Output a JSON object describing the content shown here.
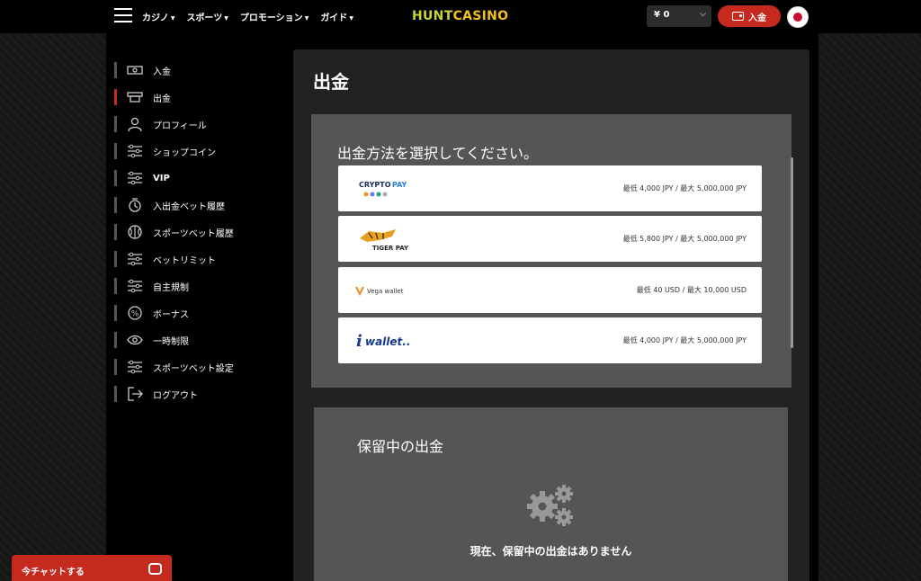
{
  "header": {
    "nav": [
      {
        "label": "カジノ"
      },
      {
        "label": "スポーツ"
      },
      {
        "label": "プロモーション"
      },
      {
        "label": "ガイド"
      }
    ],
    "logo_part1": "HUNT",
    "logo_part2": "CASINO",
    "balance": "¥ 0",
    "deposit_label": "入金"
  },
  "sidebar": {
    "items": [
      {
        "label": "入金",
        "icon": "cash-icon"
      },
      {
        "label": "出金",
        "icon": "cash-out-icon",
        "active": true
      },
      {
        "label": "プロフィール",
        "icon": "user-icon"
      },
      {
        "label": "ショップコイン",
        "icon": "sliders-icon"
      },
      {
        "label": "VIP",
        "icon": "sliders-icon"
      },
      {
        "label": "入出金ベット履歴",
        "icon": "history-icon"
      },
      {
        "label": "スポーツベット履歴",
        "icon": "ball-icon"
      },
      {
        "label": "ベットリミット",
        "icon": "sliders-icon"
      },
      {
        "label": "自主規制",
        "icon": "sliders-icon"
      },
      {
        "label": "ボーナス",
        "icon": "percent-icon"
      },
      {
        "label": "一時制限",
        "icon": "eye-icon"
      },
      {
        "label": "スポーツベット設定",
        "icon": "sliders-icon"
      },
      {
        "label": "ログアウト",
        "icon": "logout-icon"
      }
    ]
  },
  "main": {
    "title": "出金",
    "method_heading": "出金方法を選択してください。",
    "methods": [
      {
        "name": "CRYPTOPAY",
        "name_accent": "PAY",
        "limit": "最低 4,000 JPY / 最大 5,000,000 JPY"
      },
      {
        "name": "TIGER PAY",
        "limit": "最低 5,800 JPY / 最大 5,000,000 JPY"
      },
      {
        "name": "Vega wallet",
        "limit": "最低 40 USD / 最大 10,000 USD"
      },
      {
        "name": "wallet..",
        "limit": "最低 4,000 JPY / 最大 5,000,000 JPY"
      }
    ],
    "pending_title": "保留中の出金",
    "pending_empty": "現在、保留中の出金はありません"
  },
  "chat": {
    "label": "今チャットする"
  },
  "colors": {
    "accent": "#c62a1f",
    "logo_yellow": "#f0c01e",
    "card": "#555555",
    "panel": "#222222"
  }
}
